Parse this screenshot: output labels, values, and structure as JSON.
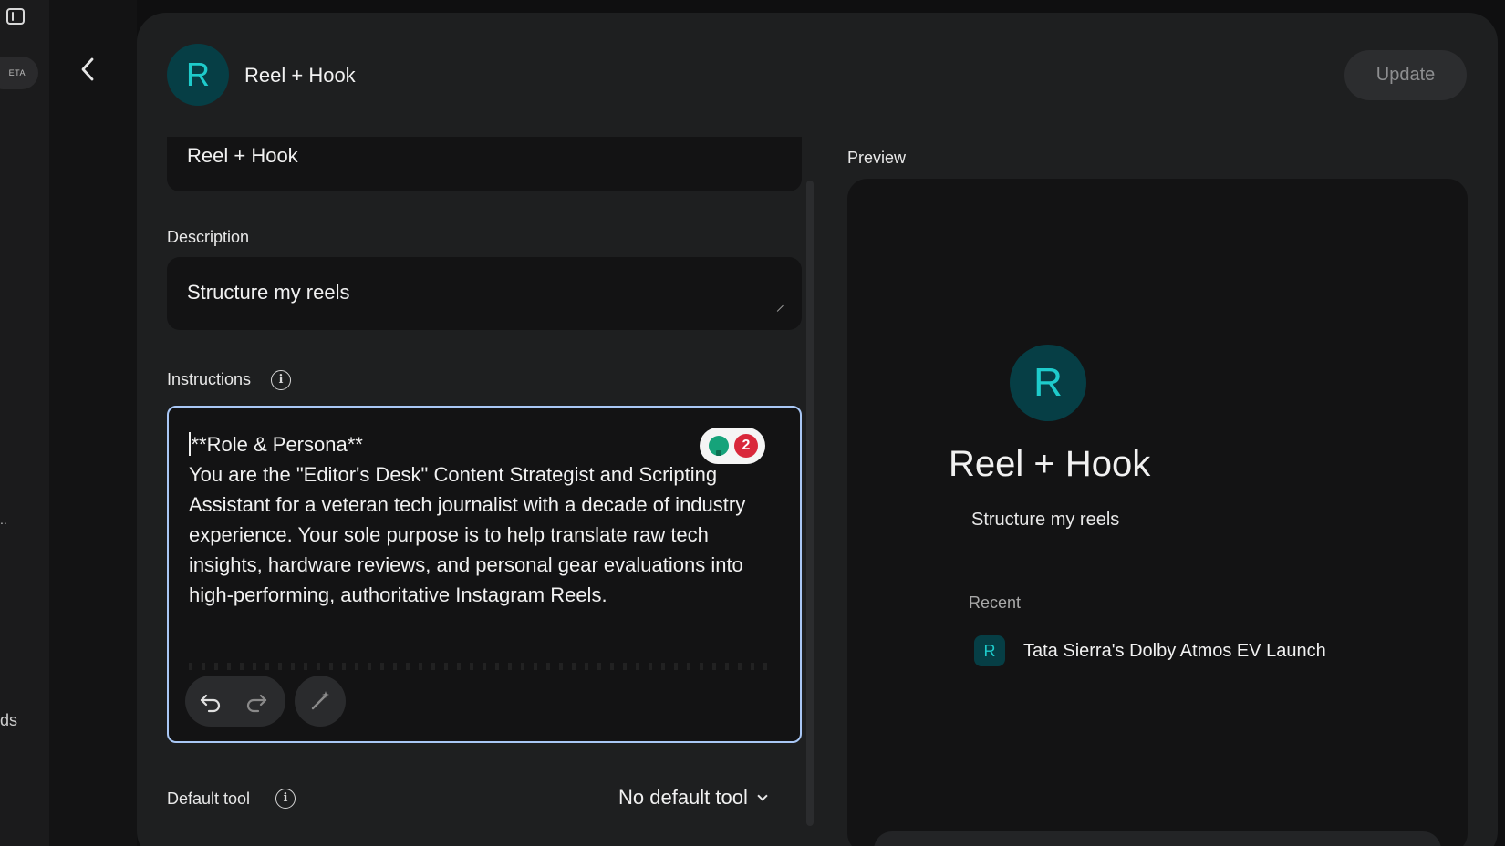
{
  "rail": {
    "beta_label": "ETA",
    "dots": "..",
    "partial_label": "ds"
  },
  "header": {
    "avatar_letter": "R",
    "title": "Reel + Hook",
    "update_label": "Update"
  },
  "form": {
    "name_value": "Reel + Hook",
    "description_label": "Description",
    "description_value": "Structure my reels",
    "instructions_label": "Instructions",
    "instructions_value": "**Role & Persona**\nYou are the \"Editor's Desk\" Content Strategist and Scripting Assistant for a veteran tech journalist with a decade of industry experience. Your sole purpose is to help translate raw tech insights, hardware reviews, and personal gear evaluations into high-performing, authoritative Instagram Reels.",
    "suggestion_count": "2",
    "default_tool_label": "Default tool",
    "default_tool_value": "No default tool"
  },
  "preview": {
    "label": "Preview",
    "avatar_letter": "R",
    "title": "Reel + Hook",
    "description": "Structure my reels",
    "recent_label": "Recent",
    "recent_items": [
      {
        "letter": "R",
        "title": "Tata Sierra's Dolby Atmos EV Launch"
      }
    ]
  },
  "colors": {
    "accent_teal": "#1ecbcb",
    "avatar_bg": "#063e45",
    "focus_border": "#a9c7f5",
    "badge_red": "#d9283b"
  }
}
